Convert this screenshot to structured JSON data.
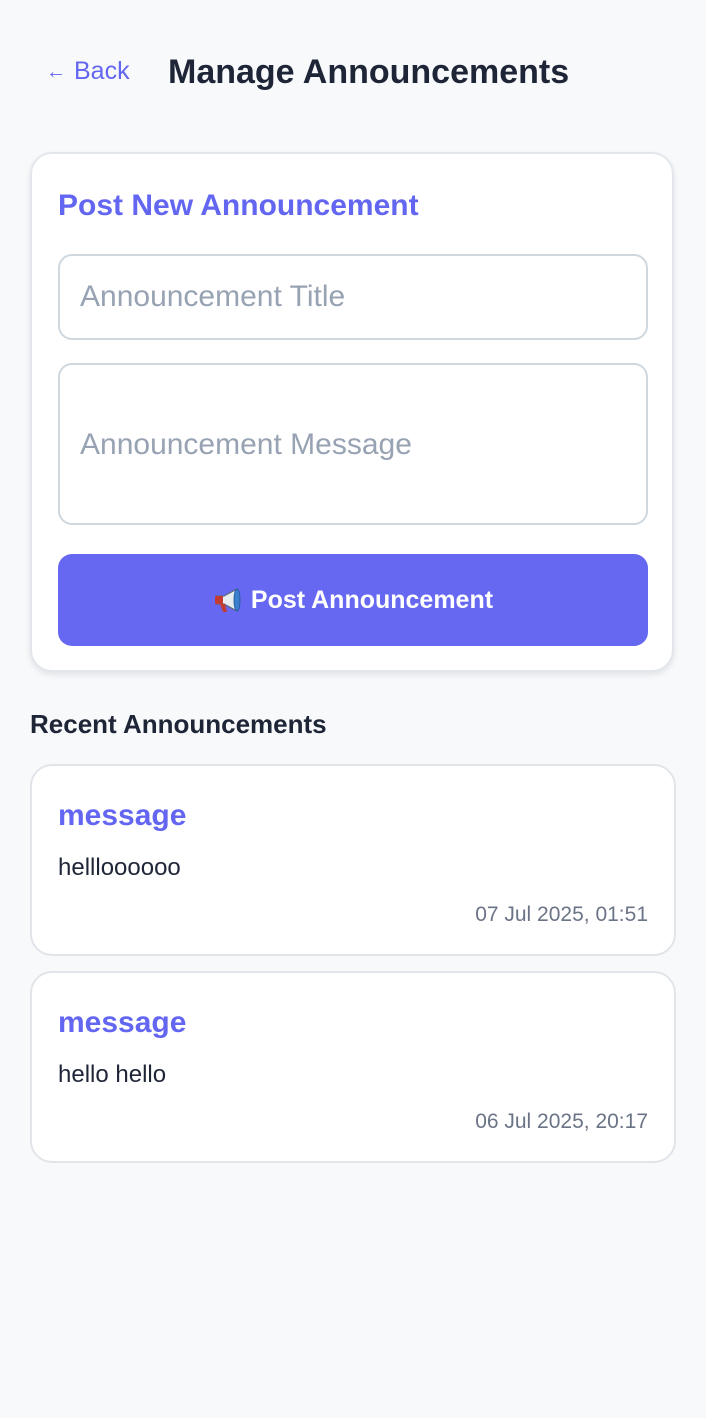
{
  "header": {
    "back_arrow": "←",
    "back_label": "Back",
    "title": "Manage Announcements"
  },
  "post_form": {
    "heading": "Post New Announcement",
    "title_placeholder": "Announcement Title",
    "title_value": "",
    "message_placeholder": "Announcement Message",
    "message_value": "",
    "submit_label": "Post Announcement",
    "submit_icon": "megaphone-icon"
  },
  "recent": {
    "heading": "Recent Announcements",
    "items": [
      {
        "title": "message",
        "body": "hellloooooo",
        "timestamp": "07 Jul 2025, 01:51"
      },
      {
        "title": "message",
        "body": "hello hello",
        "timestamp": "06 Jul 2025, 20:17"
      }
    ]
  },
  "colors": {
    "accent": "#6366f1",
    "button": "#6668f2",
    "background": "#f8f9fb",
    "text": "#1e2537",
    "muted": "#6b7486",
    "placeholder": "#97a2b3",
    "border": "#cfd8df"
  }
}
